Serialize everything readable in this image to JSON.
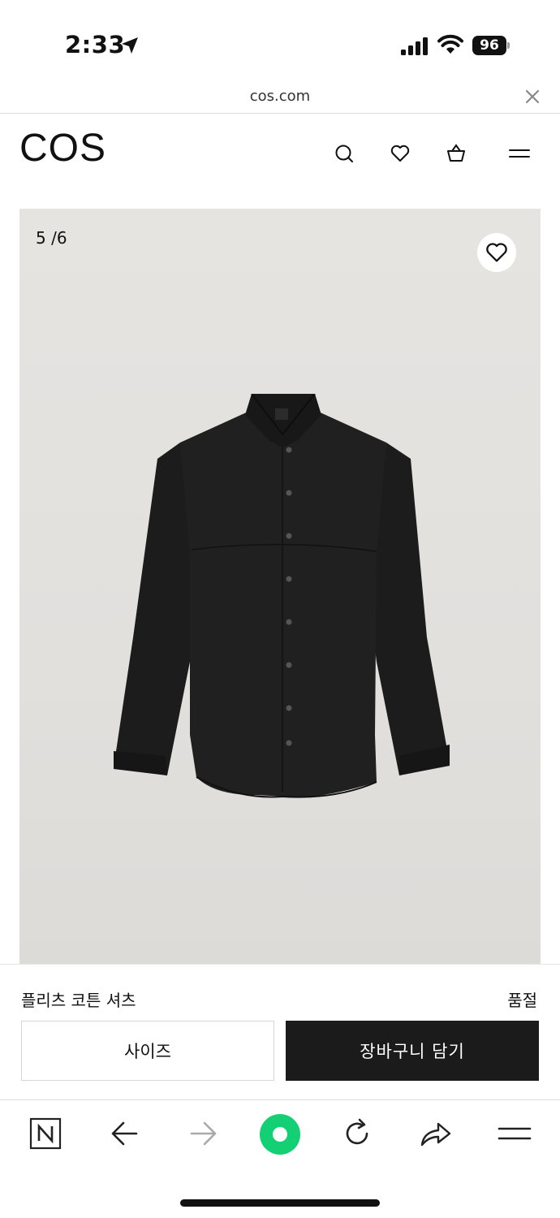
{
  "status_bar": {
    "time": "2:33",
    "battery": "96"
  },
  "url_bar": {
    "url": "cos.com"
  },
  "header": {
    "logo": "COS",
    "icons": [
      "search-icon",
      "heart-icon",
      "bag-icon",
      "menu-icon"
    ]
  },
  "product_image": {
    "counter": "5 /6"
  },
  "product": {
    "name": "플리츠 코튼 셔츠",
    "status": "품절",
    "size_label": "사이즈",
    "cart_label": "장바구니 담기"
  },
  "toolbar": {
    "icons": [
      "naver-n-icon",
      "back-arrow-icon",
      "forward-arrow-icon",
      "green-home-icon",
      "refresh-icon",
      "share-icon",
      "menu-icon"
    ]
  },
  "colors": {
    "accent_green": "#12d073",
    "button_dark": "#1b1b1b",
    "image_bg": "#e4e2df"
  }
}
